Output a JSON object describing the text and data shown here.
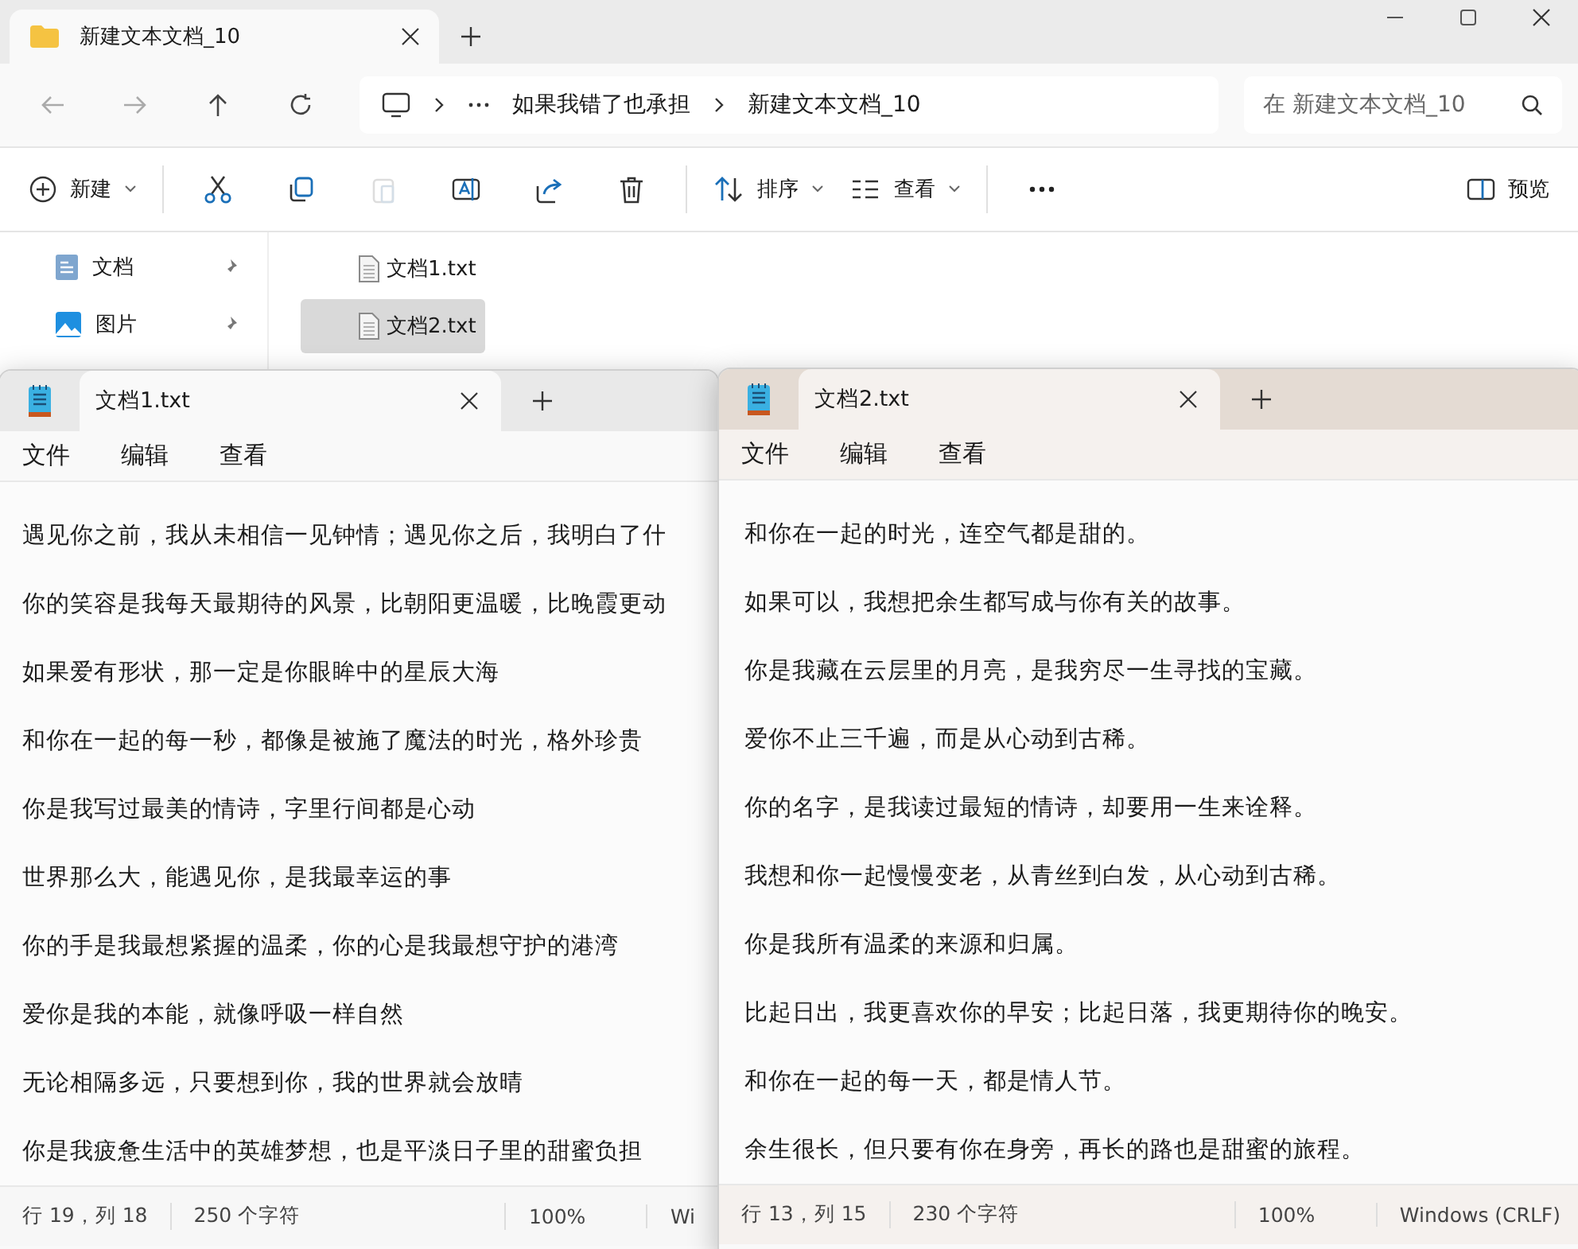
{
  "explorer": {
    "tab": {
      "title": "新建文本文档_10"
    },
    "address": {
      "crumbs": [
        "如果我错了也承担",
        "新建文本文档_10"
      ]
    },
    "search": {
      "placeholder": "在 新建文本文档_10"
    },
    "toolbar": [
      {
        "kind": "new",
        "label": "新建",
        "disabled": false
      },
      {
        "kind": "cut",
        "disabled": false
      },
      {
        "kind": "copy",
        "disabled": false
      },
      {
        "kind": "paste",
        "disabled": true
      },
      {
        "kind": "rename",
        "disabled": false
      },
      {
        "kind": "share",
        "disabled": false
      },
      {
        "kind": "delete",
        "disabled": false
      },
      {
        "kind": "sort",
        "label": "排序",
        "disabled": false
      },
      {
        "kind": "view",
        "label": "查看",
        "disabled": false
      },
      {
        "kind": "more",
        "disabled": false
      }
    ],
    "preview": {
      "label": "预览"
    },
    "sidebar": [
      {
        "label": "文档",
        "pinned": true
      },
      {
        "label": "图片",
        "pinned": true
      }
    ],
    "files": [
      {
        "name": "文档1.txt",
        "selected": false
      },
      {
        "name": "文档2.txt",
        "selected": true
      }
    ]
  },
  "notepads": [
    {
      "active": false,
      "tab_title": "文档1.txt",
      "menus": [
        "文件",
        "编辑",
        "查看"
      ],
      "lines": [
        "遇见你之前，我从未相信一见钟情；遇见你之后，我明白了什",
        "你的笑容是我每天最期待的风景，比朝阳更温暖，比晚霞更动",
        "如果爱有形状，那一定是你眼眸中的星辰大海",
        "和你在一起的每一秒，都像是被施了魔法的时光，格外珍贵",
        "你是我写过最美的情诗，字里行间都是心动",
        "世界那么大，能遇见你，是我最幸运的事",
        "你的手是我最想紧握的温柔，你的心是我最想守护的港湾",
        "爱你是我的本能，就像呼吸一样自然",
        "无论相隔多远，只要想到你，我的世界就会放晴",
        "你是我疲惫生活中的英雄梦想，也是平淡日子里的甜蜜负担"
      ],
      "status": {
        "position": "行 19，列 18",
        "chars": "250 个字符",
        "zoom": "100%",
        "encoding": "Wi"
      }
    },
    {
      "active": true,
      "tab_title": "文档2.txt",
      "menus": [
        "文件",
        "编辑",
        "查看"
      ],
      "lines": [
        "和你在一起的时光，连空气都是甜的。",
        "如果可以，我想把余生都写成与你有关的故事。",
        "你是我藏在云层里的月亮，是我穷尽一生寻找的宝藏。",
        "爱你不止三千遍，而是从心动到古稀。",
        "你的名字，是我读过最短的情诗，却要用一生来诠释。",
        "我想和你一起慢慢变老，从青丝到白发，从心动到古稀。",
        "你是我所有温柔的来源和归属。",
        "比起日出，我更喜欢你的早安；比起日落，我更期待你的晚安。",
        "和你在一起的每一天，都是情人节。",
        "余生很长，但只要有你在身旁，再长的路也是甜蜜的旅程。"
      ],
      "status": {
        "position": "行 13，列 15",
        "chars": "230 个字符",
        "zoom": "100%",
        "encoding": "Windows (CRLF)"
      }
    }
  ]
}
